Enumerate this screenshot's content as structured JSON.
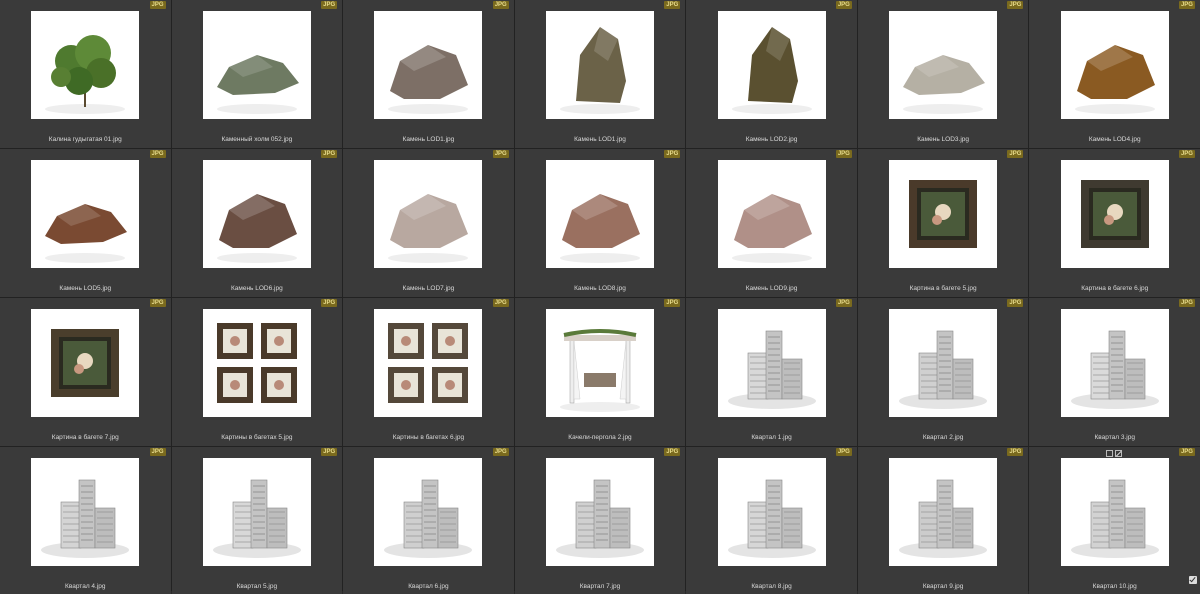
{
  "grid": {
    "items": [
      {
        "label": "Калина гудыгатая 01.jpg",
        "badge": "JPG",
        "kind": "bush",
        "color": "#4f7a2f"
      },
      {
        "label": "Каменный холм 052.jpg",
        "badge": "JPG",
        "kind": "flatrock",
        "color": "#6e7a62"
      },
      {
        "label": "Камень LOD1.jpg",
        "badge": "JPG",
        "kind": "rock",
        "color": "#7d6f66"
      },
      {
        "label": "Камень LOD1.jpg",
        "badge": "JPG",
        "kind": "tallrock",
        "color": "#6b6248"
      },
      {
        "label": "Камень LOD2.jpg",
        "badge": "JPG",
        "kind": "tallrock",
        "color": "#5a5030"
      },
      {
        "label": "Камень LOD3.jpg",
        "badge": "JPG",
        "kind": "flatrock",
        "color": "#b5b0a4"
      },
      {
        "label": "Камень LOD4.jpg",
        "badge": "JPG",
        "kind": "rock",
        "color": "#8a5a22"
      },
      {
        "label": "Камень LOD5.jpg",
        "badge": "JPG",
        "kind": "flatrock",
        "color": "#7a4a32"
      },
      {
        "label": "Камень LOD6.jpg",
        "badge": "JPG",
        "kind": "rock",
        "color": "#6a4e42"
      },
      {
        "label": "Камень LOD7.jpg",
        "badge": "JPG",
        "kind": "rock",
        "color": "#b8a8a0"
      },
      {
        "label": "Камень LOD8.jpg",
        "badge": "JPG",
        "kind": "rock",
        "color": "#9a7060"
      },
      {
        "label": "Камень LOD9.jpg",
        "badge": "JPG",
        "kind": "rock",
        "color": "#b09088"
      },
      {
        "label": "Картина в багете 5.jpg",
        "badge": "JPG",
        "kind": "frame",
        "color": "#4a3a2a"
      },
      {
        "label": "Картина в багете 6.jpg",
        "badge": "JPG",
        "kind": "frame",
        "color": "#3f3a30"
      },
      {
        "label": "Картина в багете 7.jpg",
        "badge": "JPG",
        "kind": "frame",
        "color": "#4a3e2c"
      },
      {
        "label": "Картины в багетах 5.jpg",
        "badge": "JPG",
        "kind": "frames4",
        "color": "#4a3a2a"
      },
      {
        "label": "Картины в багетах 6.jpg",
        "badge": "JPG",
        "kind": "frames4",
        "color": "#54483a"
      },
      {
        "label": "Качели-пергола 2.jpg",
        "badge": "JPG",
        "kind": "pergola",
        "color": "#8a7a6a"
      },
      {
        "label": "Квартал 1.jpg",
        "badge": "JPG",
        "kind": "city",
        "color": "#d8d8d8"
      },
      {
        "label": "Квартал 2.jpg",
        "badge": "JPG",
        "kind": "city",
        "color": "#d0d0d0"
      },
      {
        "label": "Квартал 3.jpg",
        "badge": "JPG",
        "kind": "city",
        "color": "#dadada"
      },
      {
        "label": "Квартал 4.jpg",
        "badge": "JPG",
        "kind": "city",
        "color": "#d4d4d4"
      },
      {
        "label": "Квартал 5.jpg",
        "badge": "JPG",
        "kind": "city",
        "color": "#d8d8d8"
      },
      {
        "label": "Квартал 6.jpg",
        "badge": "JPG",
        "kind": "city",
        "color": "#cfcfcf"
      },
      {
        "label": "Квартал 7.jpg",
        "badge": "JPG",
        "kind": "city",
        "color": "#d0d0d0"
      },
      {
        "label": "Квартал 8.jpg",
        "badge": "JPG",
        "kind": "city",
        "color": "#d6d6d6"
      },
      {
        "label": "Квартал 9.jpg",
        "badge": "JPG",
        "kind": "city",
        "color": "#cccccc"
      },
      {
        "label": "Квартал 10.jpg",
        "badge": "JPG",
        "kind": "city",
        "color": "#d2d2d2",
        "selected": true
      }
    ]
  }
}
